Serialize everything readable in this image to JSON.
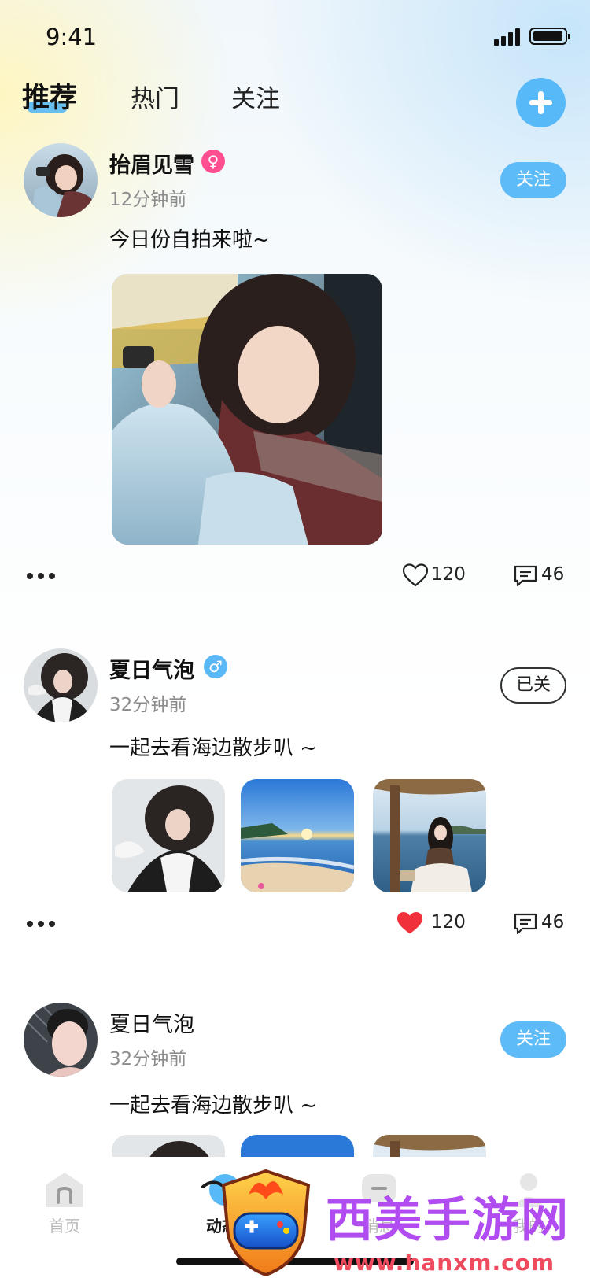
{
  "status_bar": {
    "time": "9:41"
  },
  "header": {
    "tabs": [
      {
        "label": "推荐",
        "active": true
      },
      {
        "label": "热门",
        "active": false
      },
      {
        "label": "关注",
        "active": false
      }
    ],
    "add_icon": "plus-icon"
  },
  "posts": [
    {
      "username": "抬眉见雪",
      "gender": "female",
      "gender_symbol": "♀",
      "time": "12分钟前",
      "follow_label": "关注",
      "followed": false,
      "text": "今日份自拍来啦~",
      "image_count": 1,
      "liked": false,
      "likes": "120",
      "comments": "46"
    },
    {
      "username": "夏日气泡",
      "gender": "male",
      "gender_symbol": "♂",
      "time": "32分钟前",
      "follow_label": "已关",
      "followed": true,
      "text": "一起去看海边散步叭 ~",
      "image_count": 3,
      "liked": true,
      "likes": "120",
      "comments": "46"
    },
    {
      "username": "夏日气泡",
      "time": "32分钟前",
      "follow_label": "关注",
      "followed": false,
      "text": "一起去看海边散步叭 ~",
      "image_count": 3
    }
  ],
  "tab_bar": {
    "items": [
      {
        "label": "首页",
        "icon": "home-icon",
        "active": false
      },
      {
        "label": "动态",
        "icon": "moments-icon",
        "active": true
      },
      {
        "label": "消息",
        "icon": "message-icon",
        "active": false
      },
      {
        "label": "我的",
        "icon": "profile-icon",
        "active": false
      }
    ]
  },
  "watermark": {
    "title": "西美手游网",
    "url": "www.hanxm.com"
  },
  "colors": {
    "accent": "#5dbbf8",
    "female": "#ff4f91",
    "like_active": "#f0303a",
    "text": "#111111",
    "muted": "#8c8c8c"
  }
}
